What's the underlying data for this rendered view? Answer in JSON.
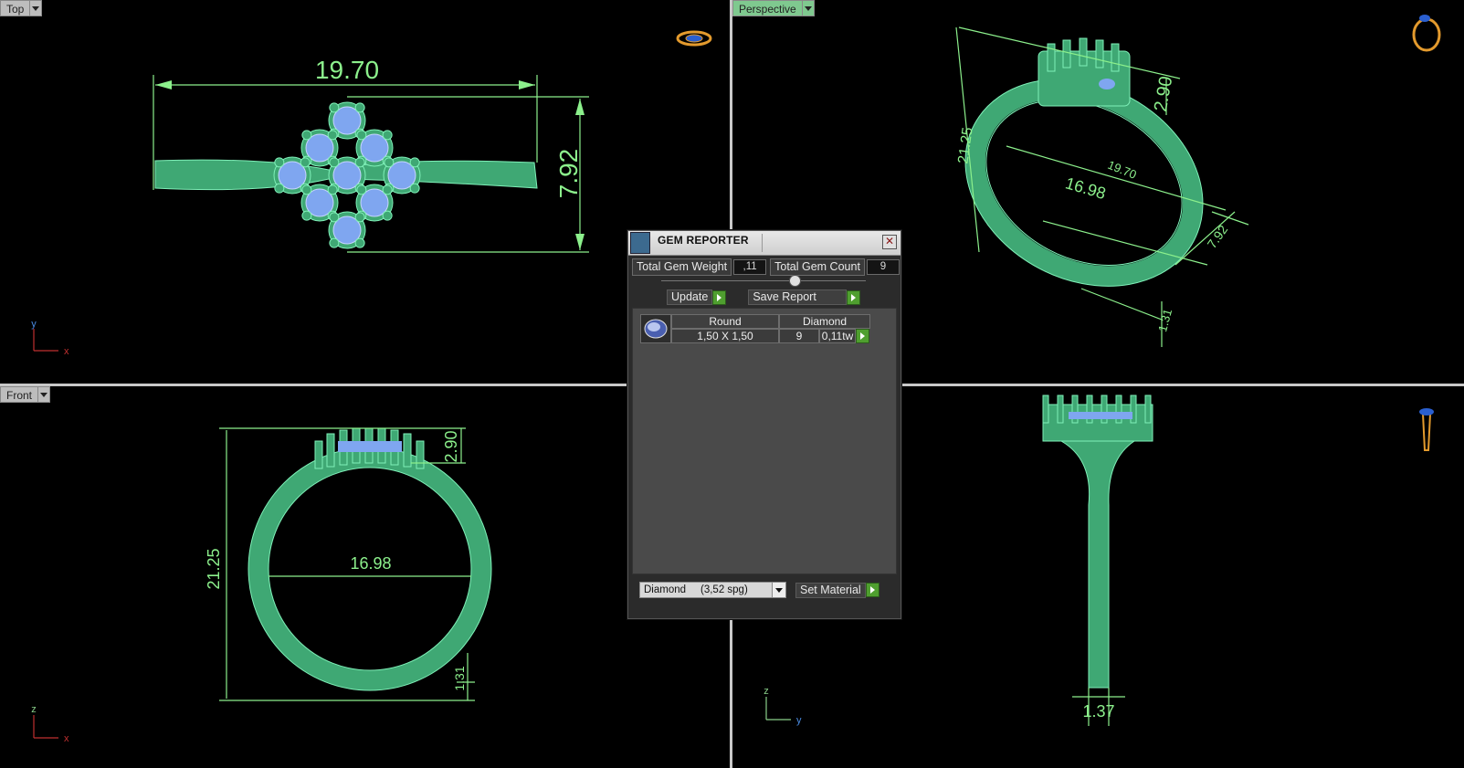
{
  "viewports": {
    "top": {
      "label": "Top"
    },
    "perspective": {
      "label": "Perspective"
    },
    "front": {
      "label": "Front"
    }
  },
  "dimensions": {
    "top": {
      "width": "19.70",
      "height": "7.92"
    },
    "perspective": {
      "ring_height": "21.25",
      "head_height": "2.90",
      "width": "19.70",
      "inner": "16.98",
      "depth": "7.92",
      "shank": "1.31",
      "small": "1.37"
    },
    "front": {
      "height": "21.25",
      "inner": "16.98",
      "head": "2.90",
      "shank": "1.31"
    },
    "side": {
      "shank": "1.37"
    }
  },
  "axes": {
    "top": [
      "y",
      "x"
    ],
    "front": [
      "z",
      "x"
    ],
    "side": [
      "z",
      "y"
    ]
  },
  "gem_reporter": {
    "title": "GEM REPORTER",
    "total_weight_label": "Total Gem Weight",
    "total_weight_value": ",11",
    "total_count_label": "Total Gem Count",
    "total_count_value": "9",
    "update_label": "Update",
    "save_report_label": "Save Report",
    "table": {
      "shape": "Round",
      "type": "Diamond",
      "size": "1,50 X 1,50",
      "count": "9",
      "weight": "0,11tw"
    },
    "material_select": "Diamond     (3,52 spg)",
    "set_material_label": "Set Material"
  },
  "colors": {
    "ring": "#5fd49a",
    "dimension": "#8cf08c",
    "gem": "#7fa6f0"
  }
}
